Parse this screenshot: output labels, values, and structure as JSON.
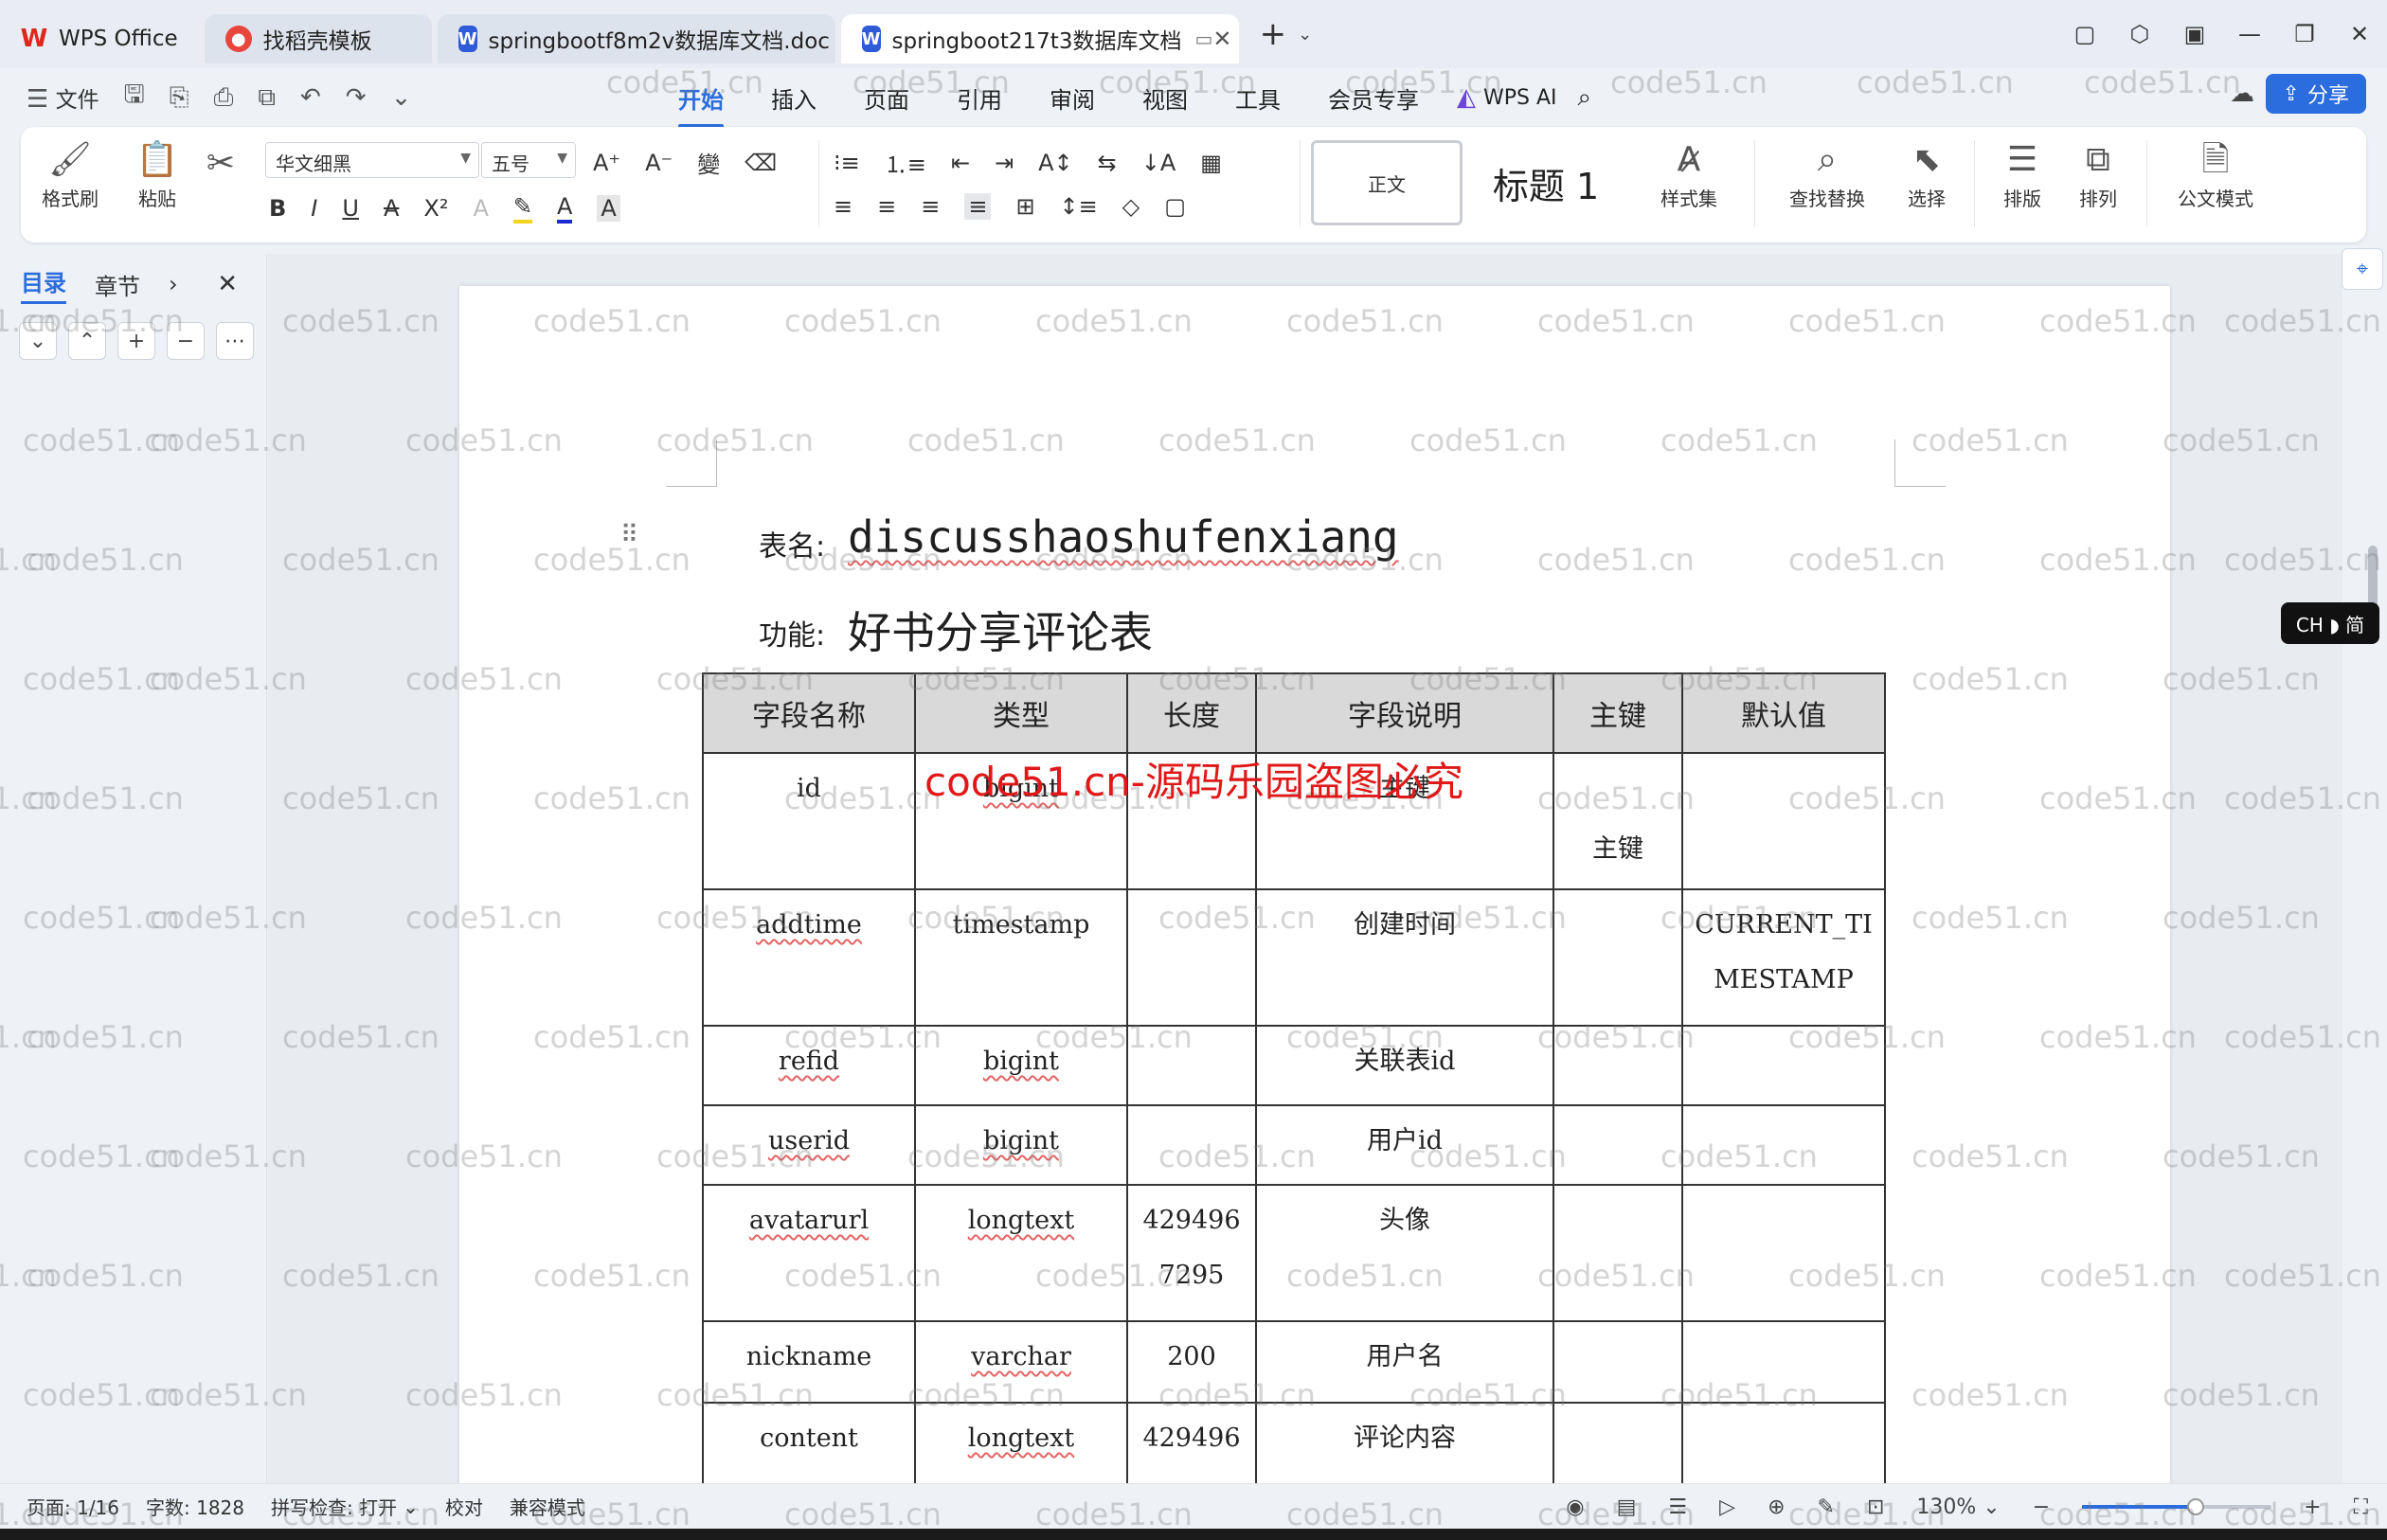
{
  "tabs": [
    {
      "label": "WPS Office",
      "icon": "wps-logo-icon"
    },
    {
      "label": "找稻壳模板",
      "icon": "docer-icon"
    },
    {
      "label": "springbootf8m2v数据库文档.doc",
      "icon": "word-doc-icon"
    },
    {
      "label": "springboot217t3数据库文档",
      "icon": "word-doc-icon"
    }
  ],
  "quick_access": {
    "file_label": "文件"
  },
  "menus": [
    "开始",
    "插入",
    "页面",
    "引用",
    "审阅",
    "视图",
    "工具",
    "会员专享"
  ],
  "active_menu": "开始",
  "wps_ai_label": "WPS AI",
  "share_label": "分享",
  "ribbon": {
    "format_painter": "格式刷",
    "paste": "粘贴",
    "font_name": "华文细黑",
    "font_size": "五号",
    "style_normal": "正文",
    "style_heading": "标题 1",
    "style_set": "样式集",
    "find_replace": "查找替换",
    "select": "选择",
    "layout": "排版",
    "arrange": "排列",
    "official_mode": "公文模式"
  },
  "left_pane": {
    "tab_toc": "目录",
    "tab_sections": "章节"
  },
  "document": {
    "table_name_label": "表名:",
    "table_name": "discusshaoshufenxiang",
    "function_label": "功能:",
    "function_value": "好书分享评论表",
    "headers": [
      "字段名称",
      "类型",
      "长度",
      "字段说明",
      "主键",
      "默认值"
    ],
    "rows": [
      {
        "name": "id",
        "type": "bigint",
        "length": "",
        "desc": "主键",
        "pk": "主键",
        "default": ""
      },
      {
        "name": "addtime",
        "type": "timestamp",
        "length": "",
        "desc": "创建时间",
        "pk": "",
        "default": "CURRENT_TIMESTAMP"
      },
      {
        "name": "refid",
        "type": "bigint",
        "length": "",
        "desc": "关联表id",
        "pk": "",
        "default": ""
      },
      {
        "name": "userid",
        "type": "bigint",
        "length": "",
        "desc": "用户id",
        "pk": "",
        "default": ""
      },
      {
        "name": "avatarurl",
        "type": "longtext",
        "length": "4294967295",
        "desc": "头像",
        "pk": "",
        "default": ""
      },
      {
        "name": "nickname",
        "type": "varchar",
        "length": "200",
        "desc": "用户名",
        "pk": "",
        "default": ""
      },
      {
        "name": "content",
        "type": "longtext",
        "length": "429496",
        "desc": "评论内容",
        "pk": "",
        "default": ""
      }
    ],
    "overlay_text": "code51.cn-源码乐园盗图必究",
    "watermark_text": "code51.cn"
  },
  "ime_indicator": "CH ◗ 简",
  "status": {
    "page": "页面: 1/16",
    "words": "字数: 1828",
    "spell": "拼写检查: 打开",
    "proof": "校对",
    "compat": "兼容模式",
    "zoom": "130%",
    "zoom_level": 0.6
  }
}
